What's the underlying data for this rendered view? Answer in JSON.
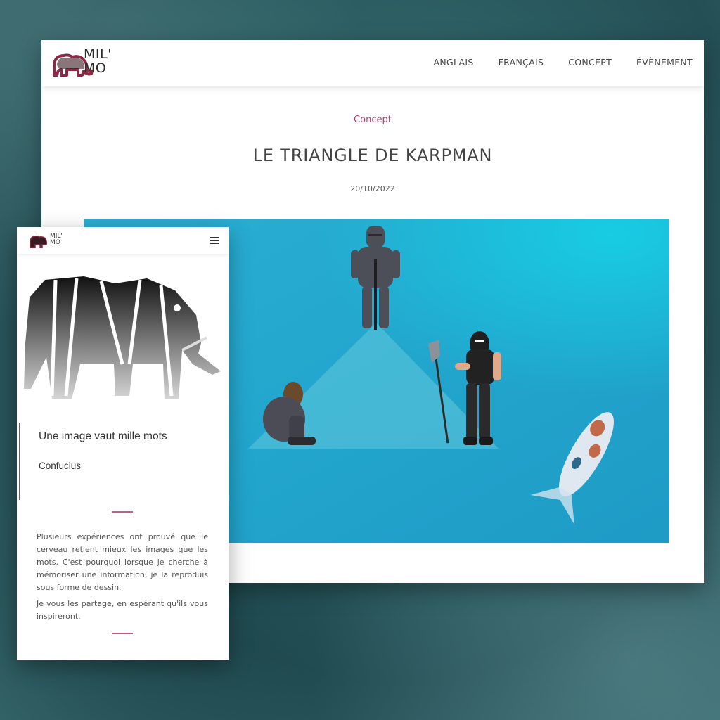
{
  "desktop": {
    "logo_text_line1": "MIL'",
    "logo_text_line2": "MO",
    "nav": [
      "ANGLAIS",
      "FRANÇAIS",
      "CONCEPT",
      "ÉVÈNEMENT"
    ],
    "category": "Concept",
    "title": "LE TRIANGLE DE KARPMAN",
    "date": "20/10/2022"
  },
  "mobile": {
    "logo_text_line1": "MIL'",
    "logo_text_line2": "MO",
    "menu_icon": "hamburger-icon",
    "quote": "Une image vaut mille mots",
    "author": "Confucius",
    "paragraphs": [
      "Plusieurs expériences ont prouvé que le cerveau retient mieux les images que les mots. C'est pourquoi lorsque je cherche à mémoriser une information, je la reproduis sous forme de dessin.",
      "Je vous les partage, en espérant qu'ils vous inspireront."
    ]
  },
  "colors": {
    "accent": "#b53d6c",
    "sea": "#2bb3d4",
    "logo": "#8a2a44"
  }
}
